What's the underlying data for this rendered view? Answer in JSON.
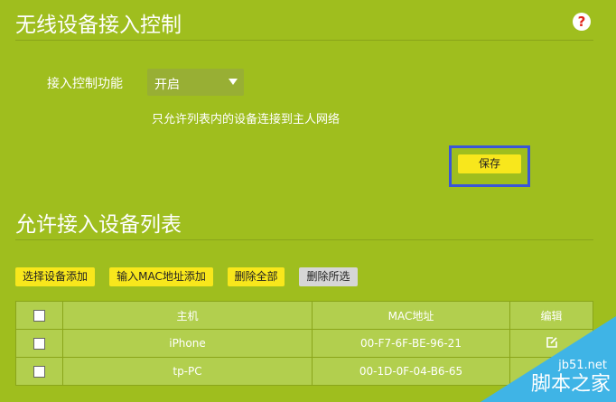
{
  "header": {
    "title": "无线设备接入控制",
    "help_icon": "?"
  },
  "control": {
    "label": "接入控制功能",
    "selected": "开启",
    "description": "只允许列表内的设备连接到主人网络",
    "save_label": "保存"
  },
  "list": {
    "title": "允许接入设备列表",
    "buttons": [
      "选择设备添加",
      "输入MAC地址添加",
      "删除全部",
      "删除所选"
    ],
    "columns": [
      "主机",
      "MAC地址",
      "编辑"
    ],
    "rows": [
      {
        "host": "iPhone",
        "mac": "00-F7-6F-BE-96-21"
      },
      {
        "host": "tp-PC",
        "mac": "00-1D-0F-04-B6-65"
      }
    ]
  },
  "watermark": {
    "site": "jb51.net",
    "name": "脚本之家"
  },
  "colors": {
    "background": "#9fbe1e",
    "button": "#f8e71c",
    "focus": "#3a55d8"
  }
}
